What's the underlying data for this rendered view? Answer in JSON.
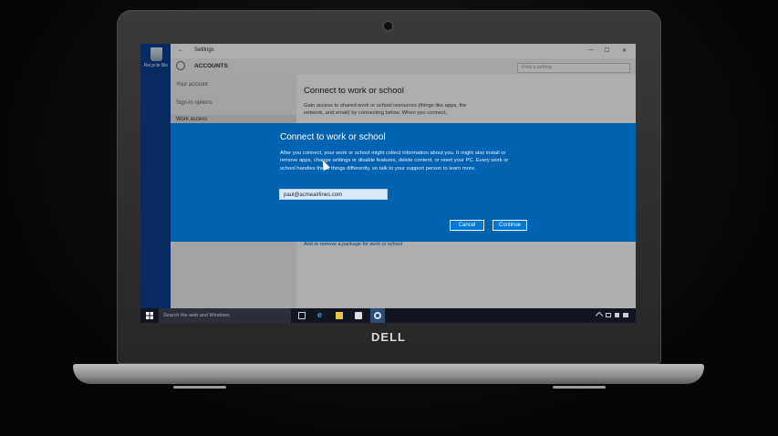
{
  "desktop": {
    "recycle_bin": "Recycle Bin"
  },
  "window": {
    "title": "Settings",
    "back_glyph": "←",
    "minimize_glyph": "—",
    "maximize_glyph": "☐",
    "close_glyph": "✕",
    "section": "ACCOUNTS",
    "search_placeholder": "Find a setting"
  },
  "sidebar": {
    "items": [
      "Your account",
      "Sign-in options",
      "Work access"
    ]
  },
  "page": {
    "heading": "Connect to work or school",
    "description": "Gain access to shared work or school resources (things like apps, the network, and email) by connecting below. When you connect,",
    "link": "Add or remove a package for work or school"
  },
  "dialog": {
    "title": "Connect to work or school",
    "body": "After you connect, your work or school might collect information about you. It might also install or remove apps, change settings or disable features, delete content, or reset your PC. Every work or school handles these things differently, so talk to your support person to learn more.",
    "email_value": "paul@acmeairlines.com",
    "cancel_label": "Cancel",
    "continue_label": "Continue"
  },
  "taskbar": {
    "search_placeholder": "Search the web and Windows",
    "icons": [
      "task-view-icon",
      "edge-icon",
      "file-explorer-icon",
      "store-icon",
      "settings-icon"
    ]
  },
  "laptop": {
    "brand": "DELL"
  }
}
